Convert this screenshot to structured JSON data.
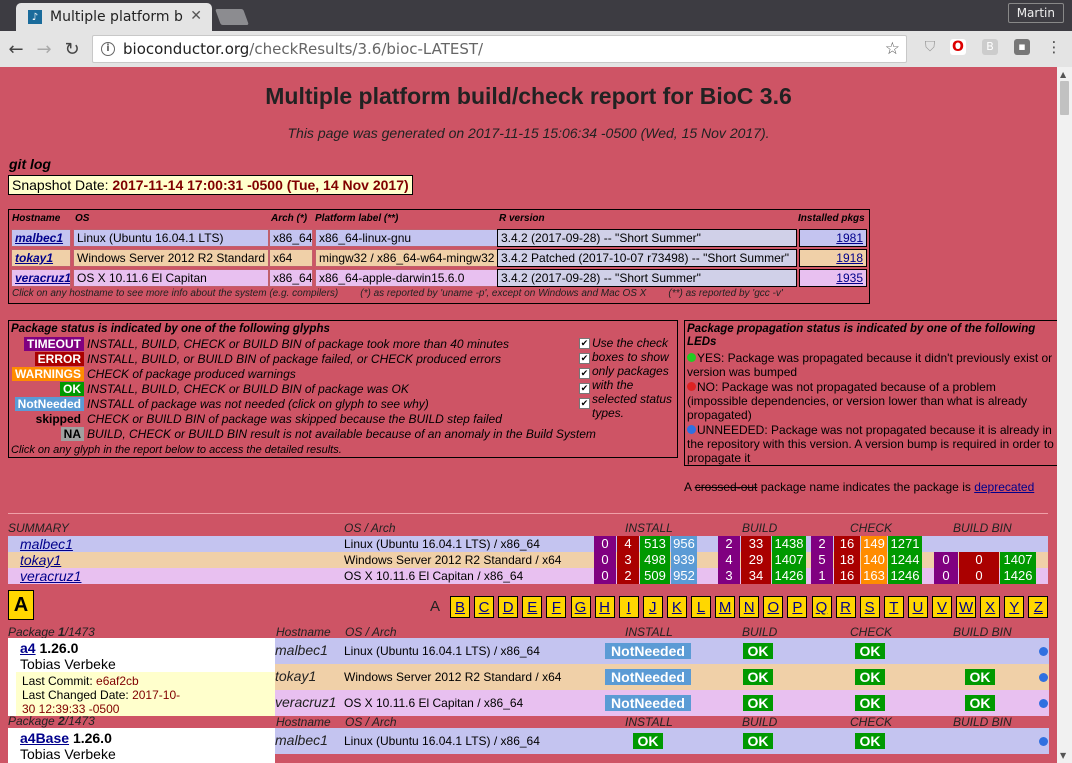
{
  "browser": {
    "tab_title": "Multiple platform b",
    "user": "Martin",
    "url_host": "bioconductor.org",
    "url_path": "/checkResults/3.6/bioc-LATEST/"
  },
  "page": {
    "title": "Multiple platform build/check report for BioC 3.6",
    "generated": "This page was generated on 2017-11-15 15:06:34 -0500 (Wed, 15 Nov 2017).",
    "git_log": "git log",
    "snapshot_label": "Snapshot Date: ",
    "snapshot_value": "2017-11-14 17:00:31 -0500 (Tue, 14 Nov 2017)"
  },
  "hosts": {
    "headers": [
      "Hostname",
      "OS",
      "Arch (*)",
      "Platform label (**)",
      "R version",
      "Installed pkgs"
    ],
    "rows": [
      {
        "host": "malbec1",
        "os": "Linux (Ubuntu 16.04.1 LTS)",
        "arch": "x86_64",
        "platform": "x86_64-linux-gnu",
        "r": "3.4.2 (2017-09-28) -- \"Short Summer\"",
        "pkgs": "1981",
        "color": "#c4c4f0"
      },
      {
        "host": "tokay1",
        "os": "Windows Server 2012 R2 Standard",
        "arch": "x64",
        "platform": "mingw32 / x86_64-w64-mingw32",
        "r": "3.4.2 Patched (2017-10-07 r73498) -- \"Short Summer\"",
        "pkgs": "1918",
        "color": "#f0d0a8"
      },
      {
        "host": "veracruz1",
        "os": "OS X 10.11.6 El Capitan",
        "arch": "x86_64",
        "platform": "x86_64-apple-darwin15.6.0",
        "r": "3.4.2 (2017-09-28) -- \"Short Summer\"",
        "pkgs": "1935",
        "color": "#e8c0f0"
      }
    ],
    "footer_1": "Click on any hostname to see more info about the system (e.g. compilers)",
    "footer_2": "(*) as reported by 'uname -p', except on Windows and Mac OS X",
    "footer_3": "(**) as reported by 'gcc -v'"
  },
  "glyphs": {
    "title": "Package status is indicated by one of the following glyphs",
    "rows": [
      {
        "glyph": "TIMEOUT",
        "bg": "#800080",
        "fg": "#ffffff",
        "desc": "INSTALL, BUILD, CHECK or BUILD BIN of package took more than 40 minutes"
      },
      {
        "glyph": "ERROR",
        "bg": "#aa0000",
        "fg": "#ffffff",
        "desc": "INSTALL, BUILD, or BUILD BIN of package failed, or CHECK produced errors"
      },
      {
        "glyph": "WARNINGS",
        "bg": "#ff8c00",
        "fg": "#ffffff",
        "desc": "CHECK of package produced warnings"
      },
      {
        "glyph": "OK",
        "bg": "#009900",
        "fg": "#ffffff",
        "desc": "INSTALL, BUILD, CHECK or BUILD BIN of package was OK"
      },
      {
        "glyph": "NotNeeded",
        "bg": "#5b9bd5",
        "fg": "#ffffff",
        "desc": "INSTALL of package was not needed (click on glyph to see why)"
      },
      {
        "glyph": "skipped",
        "bg": "transparent",
        "fg": "#000000",
        "desc": "CHECK or BUILD BIN of package was skipped because the BUILD step failed"
      },
      {
        "glyph": "NA",
        "bg": "#a0a0a0",
        "fg": "#000000",
        "desc": "BUILD, CHECK or BUILD BIN result is not available because of an anomaly in the Build System"
      }
    ],
    "checkbox_label": "Use the check boxes to show only packages with the selected status types.",
    "footer": "Click on any glyph in the report below to access the detailed results."
  },
  "propagation": {
    "title": "Package propagation status is indicated by one of the following LEDs",
    "yes": "YES: Package was propagated because it didn't previously exist or version was bumped",
    "no": "NO: Package was not propagated because of a problem (impossible dependencies, or version lower than what is already propagated)",
    "unneeded": "UNNEEDED: Package was not propagated because it is already in the repository with this version. A version bump is required in order to propagate it"
  },
  "deprecated": {
    "prefix": "A ",
    "crossed": "crossed-out",
    "middle": " package name indicates the package is ",
    "link": "deprecated"
  },
  "summary": {
    "headers": [
      "SUMMARY",
      "OS / Arch",
      "INSTALL",
      "BUILD",
      "CHECK",
      "BUILD BIN"
    ],
    "rows": [
      {
        "host": "malbec1",
        "os": "Linux (Ubuntu 16.04.1 LTS) / x86_64",
        "install": [
          "0",
          "4",
          "513",
          "956"
        ],
        "build": [
          "2",
          "33",
          "1438"
        ],
        "check": [
          "2",
          "16",
          "149",
          "1271"
        ],
        "bin": []
      },
      {
        "host": "tokay1",
        "os": "Windows Server 2012 R2 Standard / x64",
        "install": [
          "0",
          "3",
          "498",
          "939"
        ],
        "build": [
          "4",
          "29",
          "1407"
        ],
        "check": [
          "5",
          "18",
          "140",
          "1244"
        ],
        "bin": [
          "0",
          "0",
          "1407"
        ]
      },
      {
        "host": "veracruz1",
        "os": "OS X 10.11.6 El Capitan / x86_64",
        "install": [
          "0",
          "2",
          "509",
          "952"
        ],
        "build": [
          "3",
          "34",
          "1426"
        ],
        "check": [
          "1",
          "16",
          "163",
          "1246"
        ],
        "bin": [
          "0",
          "0",
          "1426"
        ]
      }
    ]
  },
  "alphabet": {
    "current": "A",
    "letters": [
      "A",
      "B",
      "C",
      "D",
      "E",
      "F",
      "G",
      "H",
      "I",
      "J",
      "K",
      "L",
      "M",
      "N",
      "O",
      "P",
      "Q",
      "R",
      "S",
      "T",
      "U",
      "V",
      "W",
      "X",
      "Y",
      "Z"
    ]
  },
  "packages": {
    "pkg1": {
      "counter_a": "Package ",
      "counter_num": "1",
      "counter_b": "/1473",
      "name": "a4",
      "version": "1.26.0",
      "author": "Tobias Verbeke",
      "commit_label": "Last Commit: ",
      "commit": "e6af2cb",
      "changed_label": "Last Changed Date: ",
      "changed_1": "2017-10-",
      "changed_2": "30 12:39:33 -0500",
      "hdr": [
        "Hostname",
        "OS / Arch",
        "INSTALL",
        "BUILD",
        "CHECK",
        "BUILD BIN"
      ],
      "rows": [
        {
          "host": "malbec1",
          "os": "Linux (Ubuntu 16.04.1 LTS) / x86_64",
          "install": "NotNeeded",
          "build": "OK",
          "check": "OK",
          "bin": ""
        },
        {
          "host": "tokay1",
          "os": "Windows Server 2012 R2 Standard / x64",
          "install": "NotNeeded",
          "build": "OK",
          "check": "OK",
          "bin": "OK"
        },
        {
          "host": "veracruz1",
          "os": "OS X 10.11.6 El Capitan / x86_64",
          "install": "NotNeeded",
          "build": "OK",
          "check": "OK",
          "bin": "OK"
        }
      ]
    },
    "pkg2": {
      "counter_a": "Package ",
      "counter_num": "2",
      "counter_b": "/1473",
      "name": "a4Base",
      "version": "1.26.0",
      "author": "Tobias Verbeke",
      "rows": [
        {
          "host": "malbec1",
          "os": "Linux (Ubuntu 16.04.1 LTS) / x86_64",
          "install": "OK",
          "build": "OK",
          "check": "OK",
          "bin": ""
        }
      ]
    }
  }
}
